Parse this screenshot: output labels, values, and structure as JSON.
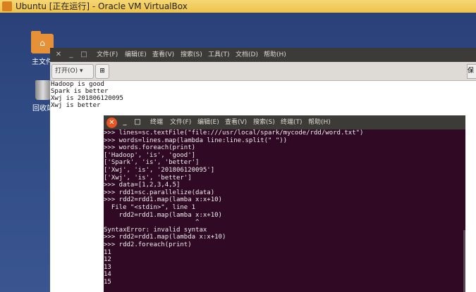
{
  "window_title": "Ubuntu [正在运行] - Oracle VM VirtualBox",
  "desktop_icons": [
    {
      "label": "主文件",
      "icon": "home-folder-icon"
    },
    {
      "label": "回收站",
      "icon": "trash-icon"
    }
  ],
  "gedit": {
    "menu": [
      "文件(F)",
      "编辑(E)",
      "查看(V)",
      "搜索(S)",
      "工具(T)",
      "文档(D)",
      "帮助(H)"
    ],
    "open_label": "打开(O) ▾",
    "save_label": "保",
    "lines": [
      "Hadoop is good",
      "Spark is better",
      "Xwj is 201806120095",
      "Xwj is better"
    ]
  },
  "terminal": {
    "menu": [
      "终端",
      "文件(F)",
      "编辑(E)",
      "查看(V)",
      "搜索(S)",
      "终端(T)",
      "帮助(H)"
    ],
    "lines": [
      ">>> lines=sc.textFile(\"file:///usr/local/spark/mycode/rdd/word.txt\")",
      ">>> words=lines.map(lambda line:line.split(\" \"))",
      ">>> words.foreach(print)",
      "['Hadoop', 'is', 'good']",
      "['Spark', 'is', 'better']",
      "['Xwj', 'is', '201806120095']",
      "['Xwj', 'is', 'better']",
      ">>> data=[1,2,3,4,5]",
      ">>> rdd1=sc.parallelize(data)",
      ">>> rdd2=rdd1.map(lamba x:x+10)",
      "  File \"<stdin>\", line 1",
      "    rdd2=rdd1.map(lamba x:x+10)",
      "                        ^",
      "SyntaxError: invalid syntax",
      ">>> rdd2=rdd1.map(lambda x:x+10)",
      ">>> rdd2.foreach(print)",
      "11",
      "12",
      "13",
      "14",
      "15"
    ]
  }
}
